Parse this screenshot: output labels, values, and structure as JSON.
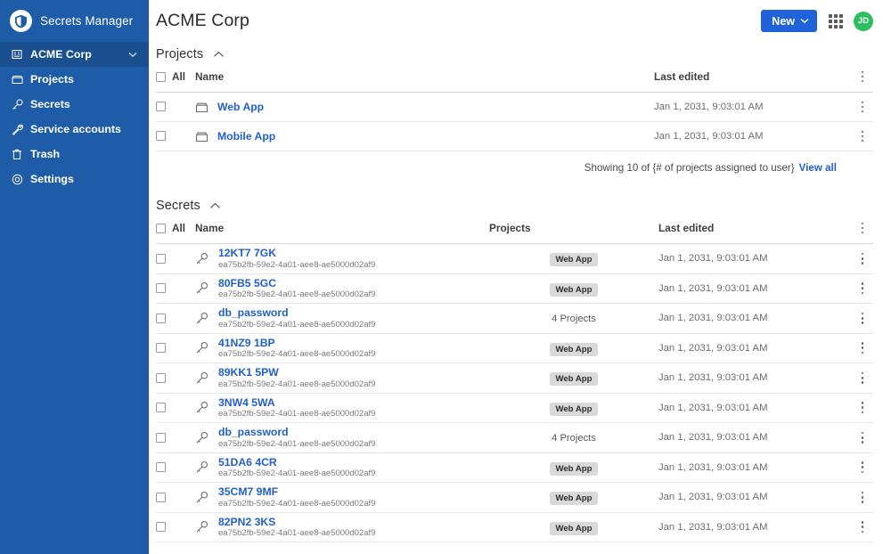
{
  "sidebar": {
    "brand": {
      "name": "Secrets Manager",
      "logo_icon": "shield-logo-icon"
    },
    "items": [
      {
        "label": "ACME Corp",
        "icon": "organization-icon",
        "active": true,
        "chevron": "chevron-down-icon"
      },
      {
        "label": "Projects",
        "icon": "folder-icon",
        "active": false
      },
      {
        "label": "Secrets",
        "icon": "key-icon",
        "active": false
      },
      {
        "label": "Service accounts",
        "icon": "wrench-icon",
        "active": false
      },
      {
        "label": "Trash",
        "icon": "trash-icon",
        "active": false
      },
      {
        "label": "Settings",
        "icon": "gear-icon",
        "active": false
      }
    ]
  },
  "header": {
    "title": "ACME Corp",
    "new_button": {
      "label": "New",
      "chevron": "chevron-down-icon"
    },
    "apps_icon": "apps-grid-icon",
    "avatar": {
      "initials": "JD",
      "color": "#2dbe60"
    }
  },
  "colors": {
    "sidebar_bg": "#1f5ca8",
    "sidebar_active_bg": "#1a4f90",
    "link_blue": "#215fce",
    "button_blue": "#1f62da",
    "badge_bg": "#d9d9d9"
  },
  "projects_section": {
    "title": "Projects",
    "collapse_icon": "chevron-up-icon",
    "columns": {
      "all": "All",
      "name": "Name",
      "last_edited": "Last edited"
    },
    "rows": [
      {
        "name": "Web App",
        "icon": "folder-icon",
        "last_edited": "Jan 1, 2031, 9:03:01 AM"
      },
      {
        "name": "Mobile App",
        "icon": "folder-icon",
        "last_edited": "Jan 1, 2031, 9:03:01 AM"
      }
    ],
    "footer": {
      "showing_text": "Showing 10 of {# of projects assigned to user}",
      "view_all": "View all"
    }
  },
  "secrets_section": {
    "title": "Secrets",
    "collapse_icon": "chevron-up-icon",
    "columns": {
      "all": "All",
      "name": "Name",
      "projects": "Projects",
      "last_edited": "Last edited"
    },
    "rows": [
      {
        "name": "12KT7 7GK",
        "uuid": "ea75b2fb-59e2-4a01-aee8-ae5000d02af9",
        "project": "Web App",
        "project_is_badge": true,
        "last_edited": "Jan 1, 2031, 9:03:01 AM",
        "icon": "key-icon"
      },
      {
        "name": "80FB5 5GC",
        "uuid": "ea75b2fb-59e2-4a01-aee8-ae5000d02af9",
        "project": "Web App",
        "project_is_badge": true,
        "last_edited": "Jan 1, 2031, 9:03:01 AM",
        "icon": "key-icon"
      },
      {
        "name": "db_password",
        "uuid": "ea75b2fb-59e2-4a01-aee8-ae5000d02af9",
        "project": "4 Projects",
        "project_is_badge": false,
        "last_edited": "Jan 1, 2031, 9:03:01 AM",
        "icon": "key-icon"
      },
      {
        "name": "41NZ9 1BP",
        "uuid": "ea75b2fb-59e2-4a01-aee8-ae5000d02af9",
        "project": "Web App",
        "project_is_badge": true,
        "last_edited": "Jan 1, 2031, 9:03:01 AM",
        "icon": "key-icon"
      },
      {
        "name": "89KK1 5PW",
        "uuid": "ea75b2fb-59e2-4a01-aee8-ae5000d02af9",
        "project": "Web App",
        "project_is_badge": true,
        "last_edited": "Jan 1, 2031, 9:03:01 AM",
        "icon": "key-icon"
      },
      {
        "name": "3NW4 5WA",
        "uuid": "ea75b2fb-59e2-4a01-aee8-ae5000d02af9",
        "project": "Web App",
        "project_is_badge": true,
        "last_edited": "Jan 1, 2031, 9:03:01 AM",
        "icon": "key-icon"
      },
      {
        "name": "db_password",
        "uuid": "ea75b2fb-59e2-4a01-aee8-ae5000d02af9",
        "project": "4 Projects",
        "project_is_badge": false,
        "last_edited": "Jan 1, 2031, 9:03:01 AM",
        "icon": "key-icon"
      },
      {
        "name": "51DA6 4CR",
        "uuid": "ea75b2fb-59e2-4a01-aee8-ae5000d02af9",
        "project": "Web App",
        "project_is_badge": true,
        "last_edited": "Jan 1, 2031, 9:03:01 AM",
        "icon": "key-icon"
      },
      {
        "name": "35CM7 9MF",
        "uuid": "ea75b2fb-59e2-4a01-aee8-ae5000d02af9",
        "project": "Web App",
        "project_is_badge": true,
        "last_edited": "Jan 1, 2031, 9:03:01 AM",
        "icon": "key-icon"
      },
      {
        "name": "82PN2 3KS",
        "uuid": "ea75b2fb-59e2-4a01-aee8-ae5000d02af9",
        "project": "Web App",
        "project_is_badge": true,
        "last_edited": "Jan 1, 2031, 9:03:01 AM",
        "icon": "key-icon"
      }
    ]
  }
}
